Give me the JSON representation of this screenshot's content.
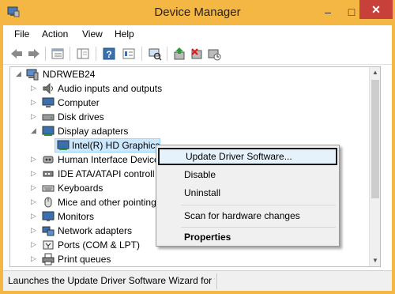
{
  "window": {
    "title": "Device Manager",
    "minimize": "–",
    "maximize": "□",
    "close": "✕"
  },
  "menu": [
    "File",
    "Action",
    "View",
    "Help"
  ],
  "toolbar": [
    "back-icon",
    "forward-icon",
    "properties-list-icon",
    "show-hide-console-tree-icon",
    "help-icon",
    "details-icon",
    "scan-hardware-icon",
    "update-driver-icon",
    "uninstall-icon",
    "disable-icon"
  ],
  "tree": {
    "root": "NDRWEB24",
    "items": [
      {
        "label": "Audio inputs and outputs",
        "icon": "audio-icon",
        "expanded": false
      },
      {
        "label": "Computer",
        "icon": "computer-icon",
        "expanded": false
      },
      {
        "label": "Disk drives",
        "icon": "disk-icon",
        "expanded": false
      },
      {
        "label": "Display adapters",
        "icon": "display-adapter-icon",
        "expanded": true
      },
      {
        "label": "Intel(R) HD Graphics",
        "icon": "display-adapter-icon",
        "child": true,
        "selected": true
      },
      {
        "label": "Human Interface Device",
        "icon": "hid-icon",
        "expanded": false
      },
      {
        "label": "IDE ATA/ATAPI controll",
        "icon": "ide-icon",
        "expanded": false
      },
      {
        "label": "Keyboards",
        "icon": "keyboard-icon",
        "expanded": false
      },
      {
        "label": "Mice and other pointing",
        "icon": "mouse-icon",
        "expanded": false
      },
      {
        "label": "Monitors",
        "icon": "monitor-icon",
        "expanded": false
      },
      {
        "label": "Network adapters",
        "icon": "network-icon",
        "expanded": false
      },
      {
        "label": "Ports (COM & LPT)",
        "icon": "port-icon",
        "expanded": false
      },
      {
        "label": "Print queues",
        "icon": "printer-icon",
        "expanded": false
      }
    ]
  },
  "context_menu": {
    "update": "Update Driver Software...",
    "disable": "Disable",
    "uninstall": "Uninstall",
    "scan": "Scan for hardware changes",
    "properties": "Properties"
  },
  "status": {
    "text": "Launches the Update Driver Software Wizard for t"
  },
  "colors": {
    "title_bar": "#f5b743",
    "close_button": "#c7413a",
    "selection": "#cce8ff",
    "menu_bg": "#f0f0f0"
  }
}
